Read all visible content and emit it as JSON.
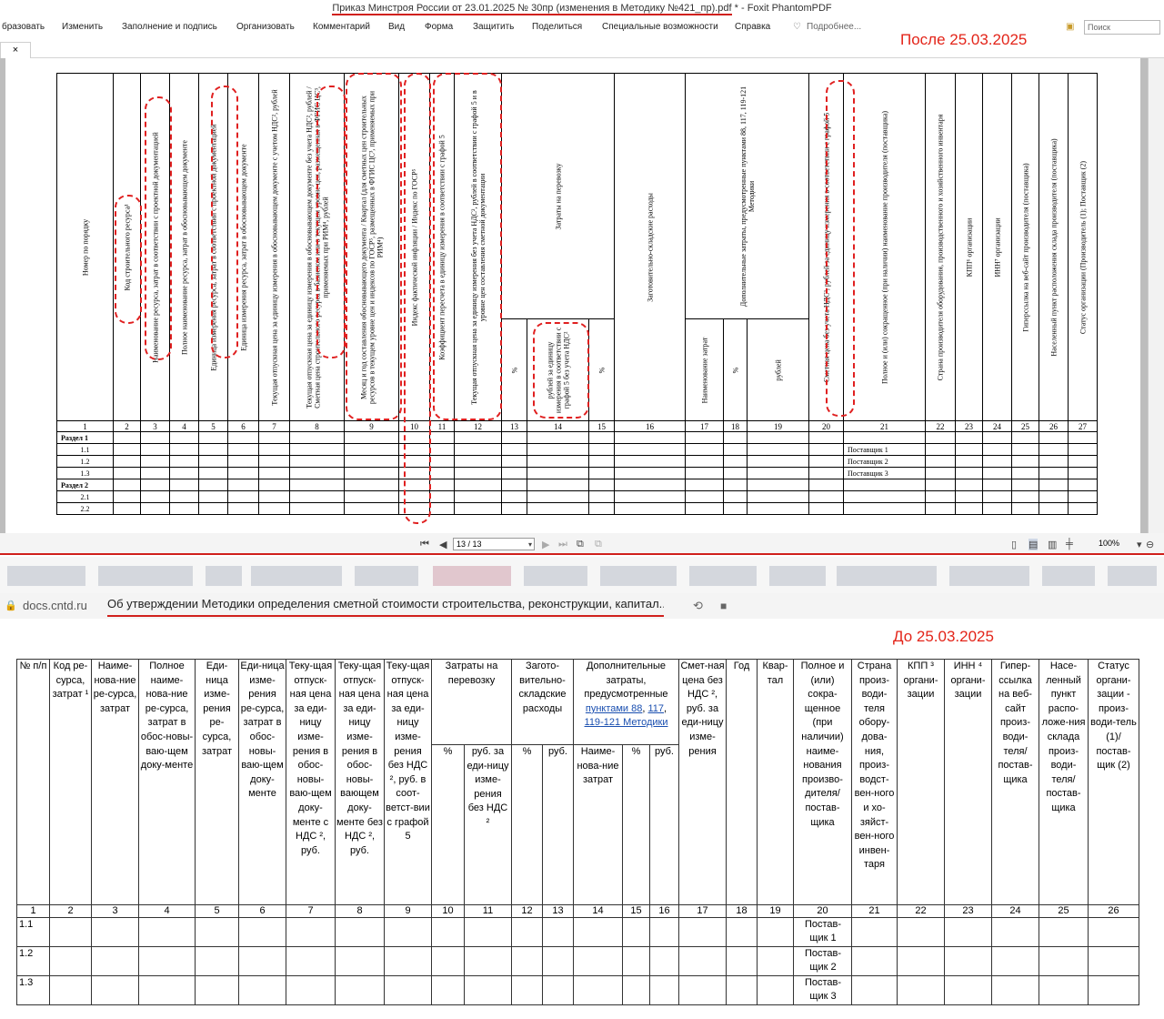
{
  "window": {
    "title_doc": "Приказ Минстроя России от 23.01.2025 № 30пр (изменения в Методику №421_пр).pdf",
    "title_app": " * - Foxit PhantomPDF"
  },
  "menu": {
    "items": [
      "бразовать",
      "Изменить",
      "Заполнение и подпись",
      "Организовать",
      "Комментарий",
      "Вид",
      "Форма",
      "Защитить",
      "Поделиться",
      "Специальные возможности",
      "Справка"
    ],
    "tellme": "Подробнее...",
    "search_placeholder": "Поиск"
  },
  "tab": {
    "close": "×"
  },
  "labels": {
    "after": "После 25.03.2025",
    "before": "До 25.03.2025"
  },
  "pdf_table": {
    "headers": [
      "Номер по порядку",
      "Код строительного ресурса¹",
      "Наименование ресурса, затрат в соответствии с проектной документацией",
      "Полное наименование ресурса, затрат в обосновывающем документе",
      "Единица измерения ресурса, затрат в соответствии с проектной документацией",
      "Единица измерения ресурса, затрат в обосновывающем документе",
      "Текущая отпускная цена за единицу измерения в обосновывающем документе с учетом НДС², рублей",
      "Текущая отпускная цена за единицу измерения в обосновывающем документе без учета НДС², рублей / Сметная цена строительного ресурса в базисном или в текущем уровне цен, размещенная в ФГИС ЦС³, применяемых при РИМ⁴, рублей",
      "Месяц и год составления обосновывающего документа / Квартал (для сметных цен строительных ресурсов в текущем уровне цен и индексов по ГОСР⁵, размещенных в ФГИС ЦС³, применяемых при РИМ⁴)",
      "Индекс фактической инфляции / Индекс по ГОСР⁵",
      "Коэффициент пересчета в единицу измерения в соответствии с графой 5",
      "Текущая отпускная цена за единицу измерения без учета НДС², рублей в соответствии с графой 5 и в уровне цен составления сметной документации",
      "Затраты на перевозку",
      "%",
      "рублей за единицу измерения в соответствии с графой 5 без учета НДС²",
      "%",
      "Заготовительно-складские расходы",
      "рублей",
      "Дополнительные затраты, предусмотренные пунктами 88, 117, 119-121 Методики",
      "Наименование затрат",
      "%",
      "рублей",
      "Сметная цена без учета НДС², рублей за единицу измерения в соответствии с графой 5",
      "Полное и (или) сокращенное (при наличии) наименование производителя (поставщика)",
      "Страна производителя оборудования, производственного и хозяйственного инвентаря",
      "КПП⁶ организации",
      "ИНН⁷ организации",
      "Гиперссылка на веб-сайт производителя (поставщика)",
      "Населенный пункт расположения склада производителя (поставщика)",
      "Статус организации (Производитель (1); Поставщик (2)"
    ],
    "col_numbers": [
      "1",
      "2",
      "3",
      "4",
      "5",
      "6",
      "7",
      "8",
      "9",
      "10",
      "11",
      "12",
      "13",
      "14",
      "15",
      "16",
      "17",
      "18",
      "19",
      "20",
      "21",
      "22",
      "23",
      "24",
      "25",
      "26",
      "27"
    ],
    "sections": [
      "Раздел 1",
      "Раздел 2"
    ],
    "rows": [
      {
        "n": "1.1",
        "supplier": "Поставщик 1"
      },
      {
        "n": "1.2",
        "supplier": "Поставщик 2"
      },
      {
        "n": "1.3",
        "supplier": "Поставщик 3"
      },
      {
        "n": "2.1",
        "supplier": ""
      },
      {
        "n": "2.2",
        "supplier": ""
      }
    ]
  },
  "status": {
    "page": "13 / 13",
    "zoom": "100%"
  },
  "browser": {
    "host": "docs.cntd.ru",
    "page_title": "Об утверждении Методики определения сметной стоимости строительства, реконструкции, капитал..."
  },
  "web_table": {
    "h": [
      "№ п/п",
      "Код ре-сурса, затрат ¹",
      "Наиме-нова-ние ре-сурса, затрат",
      "Полное наиме-нова-ние ре-сурса, затрат в обос-новы-ваю-щем доку-менте",
      "Еди-ница изме-рения ре-сурса, затрат",
      "Еди-ница изме-рения ре-сурса, затрат в обос-новы-ваю-щем доку-менте",
      "Теку-щая отпуск-ная цена за еди-ницу изме-рения в обос-новы-ваю-щем доку-менте с НДС ², руб.",
      "Теку-щая отпуск-ная цена за еди-ницу изме-рения в обос-новы-вающем доку-менте без НДС ², руб.",
      "Теку-щая отпуск-ная цена за еди-ницу изме-рения без НДС ², руб. в соот-ветст-вии с графой 5",
      "Затраты на перевозку",
      "Загото-вительно-складские расходы",
      "Дополнительные затраты, предусмотренные",
      "пунктами 88",
      "117",
      "119",
      "-121 Методики",
      "Смет-ная цена без НДС ², руб. за еди-ницу изме-рения",
      "Год",
      "Квар-тал",
      "Полное и (или) сокра-щенное (при наличии) наиме-нования произво-дителя/ постав-щика",
      "Страна произ-води-теля обору-дова-ния, произ-водст-вен-ного и хо-зяйст-вен-ного инвен-таря",
      "КПП ³ органи-зации",
      "ИНН ⁴ органи-зации",
      "Гипер-ссылка на веб-сайт произ-води-теля/ постав-щика",
      "Насе-ленный пункт распо-ложе-ния склада произ-води-теля/ постав-щика",
      "Статус органи-зации - произ-води-тель (1)/ постав-щик (2)"
    ],
    "sub": [
      "%",
      "руб. за еди-ницу изме-рения без НДС ²",
      "%",
      "руб.",
      "Наиме-нова-ние затрат",
      "%",
      "руб."
    ],
    "col_numbers": [
      "1",
      "2",
      "3",
      "4",
      "5",
      "6",
      "7",
      "8",
      "9",
      "10",
      "11",
      "12",
      "13",
      "14",
      "15",
      "16",
      "17",
      "18",
      "19",
      "20",
      "21",
      "22",
      "23",
      "24",
      "25",
      "26"
    ],
    "rows": [
      {
        "n": "1.1",
        "supplier": "Постав-щик 1"
      },
      {
        "n": "1.2",
        "supplier": "Постав-щик 2"
      },
      {
        "n": "1.3",
        "supplier": "Постав-щик 3"
      }
    ]
  },
  "colors": {
    "accent_red": "#e32419",
    "link": "#1a4fb0"
  }
}
